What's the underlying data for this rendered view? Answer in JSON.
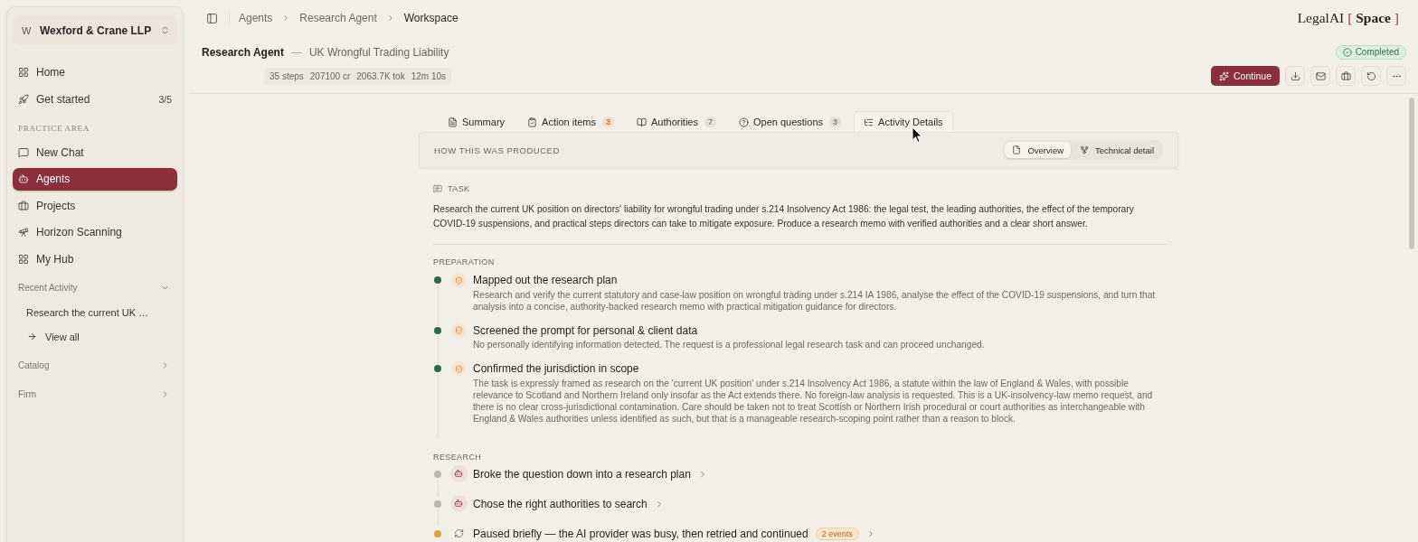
{
  "sidebar": {
    "org": {
      "initial": "W",
      "name": "Wexford & Crane LLP"
    },
    "top_items": [
      {
        "label": "Home",
        "selected": false
      },
      {
        "label": "Get started",
        "count": "3/5",
        "selected": false
      }
    ],
    "practice_area": {
      "heading": "PRACTICE AREA",
      "items": [
        {
          "label": "New Chat",
          "selected": false
        },
        {
          "label": "Agents",
          "selected": true
        },
        {
          "label": "Projects",
          "selected": false
        },
        {
          "label": "Horizon Scanning",
          "selected": false
        },
        {
          "label": "My Hub",
          "selected": false
        }
      ]
    },
    "recent_activity": {
      "heading": "Recent Activity",
      "expanded": true,
      "items": [
        {
          "label": "Research the current UK …"
        }
      ],
      "view_all": "View all"
    },
    "groups": [
      {
        "label": "Catalog",
        "expanded": false
      },
      {
        "label": "Firm",
        "expanded": false
      }
    ]
  },
  "header": {
    "breadcrumbs": [
      {
        "label": "Agents",
        "current": false
      },
      {
        "label": "Research Agent",
        "current": false
      },
      {
        "label": "Workspace",
        "current": true
      }
    ],
    "logo": {
      "name": "LegalAI",
      "open": "[",
      "word": "Space",
      "close": "]"
    },
    "title": "Research Agent",
    "separator": "—",
    "subtitle": "UK Wrongful Trading Liability",
    "status": {
      "label": "Completed"
    },
    "stats": [
      "35 steps",
      "207100 cr",
      "2063.7K tok",
      "12m 10s"
    ],
    "continue_button": "Continue"
  },
  "tabs": [
    {
      "label": "Summary",
      "selected": false
    },
    {
      "label": "Action items",
      "count": {
        "text": "3",
        "color": "#d2762a"
      },
      "selected": false
    },
    {
      "label": "Authorities",
      "count": {
        "text": "7",
        "color": "#85807a"
      },
      "selected": false
    },
    {
      "label": "Open questions",
      "count": {
        "text": "3",
        "color": "#85807a"
      },
      "selected": false
    },
    {
      "label": "Activity Details",
      "selected": true
    }
  ],
  "activity": {
    "heading": "HOW THIS WAS PRODUCED",
    "views": [
      {
        "label": "Overview",
        "selected": true
      },
      {
        "label": "Technical detail",
        "selected": false
      }
    ],
    "task": {
      "label": "TASK",
      "text": "Research the current UK position on directors' liability for wrongful trading under s.214 Insolvency Act 1986: the legal test, the leading authorities, the effect of the temporary COVID-19 suspensions, and practical steps directors can take to mitigate exposure. Produce a research memo with verified authorities and a clear short answer."
    },
    "sections": [
      {
        "heading": "PREPARATION",
        "steps": [
          {
            "kind": "check",
            "color": "#2f6a45",
            "title": "Mapped out the research plan",
            "description": "Research and verify the current statutory and case-law position on wrongful trading under s.214 IA 1986, analyse the effect of the COVID-19 suspensions, and turn that analysis into a concise, authority-backed research memo with practical mitigation guidance for directors."
          },
          {
            "kind": "check",
            "color": "#2f6a45",
            "title": "Screened the prompt for personal & client data",
            "description": "No personally identifying information detected. The request is a professional legal research task and can proceed unchanged."
          },
          {
            "kind": "check",
            "color": "#2f6a45",
            "title": "Confirmed the jurisdiction in scope",
            "description": "The task is expressly framed as research on the 'current UK position' under s.214 Insolvency Act 1986, a statute within the law of England & Wales, with possible relevance to Scotland and Northern Ireland only insofar as the Act extends there. No foreign-law analysis is requested. This is a UK-insolvency-law memo request, and there is no clear cross-jurisdictional contamination. Care should be taken not to treat Scottish or Northern Irish procedural or court authorities as interchangeable with England & Wales authorities unless identified as such, but that is a manageable research-scoping point rather than a reason to block."
          }
        ]
      },
      {
        "heading": "RESEARCH",
        "steps": [
          {
            "kind": "agent",
            "color": "#bab6af",
            "title": "Broke the question down into a research plan"
          },
          {
            "kind": "agent",
            "color": "#bab6af",
            "title": "Chose the right authorities to search"
          },
          {
            "kind": "retry",
            "color": "#e89f35",
            "title": "Paused briefly — the AI provider was busy, then retried and continued",
            "badge": "2 events"
          }
        ]
      }
    ]
  }
}
